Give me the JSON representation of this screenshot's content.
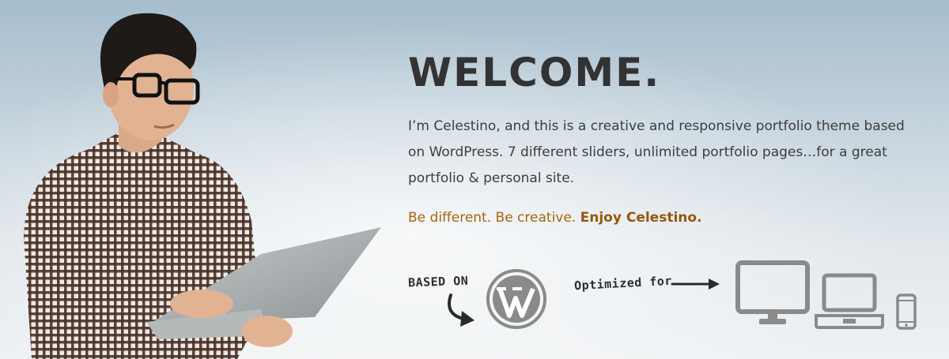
{
  "hero": {
    "title": "WELCOME.",
    "intro": "I’m Celestino, and this is a creative and responsive portfolio theme based on WordPress. 7 different sliders, unlimited portfolio pages…for a great portfolio & personal site.",
    "tagline_plain": "Be different. Be creative. ",
    "tagline_bold": "Enjoy Celestino.",
    "based_on_label": "BASED ON",
    "optimized_label": "Optimized for"
  },
  "icons": {
    "person": "man-with-laptop-image",
    "curve_arrow": "curved-arrow-icon",
    "wordpress": "wordpress-logo-icon",
    "long_arrow": "right-arrow-icon",
    "monitor": "desktop-monitor-icon",
    "laptop": "laptop-icon",
    "phone": "mobile-phone-icon"
  },
  "colors": {
    "title": "#333333",
    "body_text": "#3d3d3d",
    "accent": "#a8660a",
    "device_gray": "#8a8a8a"
  }
}
